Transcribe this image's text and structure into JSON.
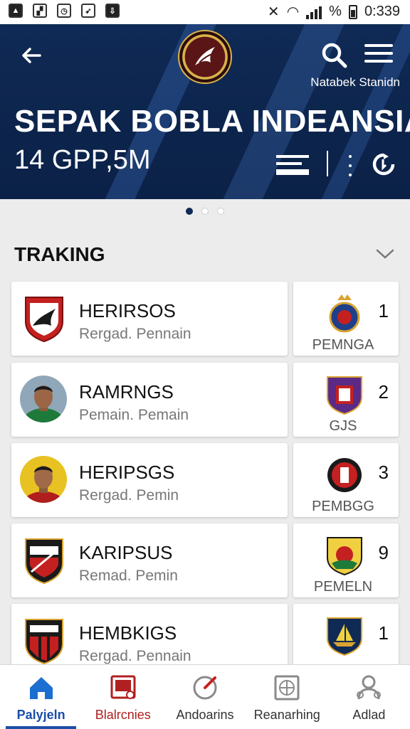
{
  "status_bar": {
    "time": "0:339",
    "battery_text": "%"
  },
  "header": {
    "title": "SEPAK BOBLA INDEANSIA",
    "subtitle": "14 GPP,5M",
    "username": "Natabek Stanidn",
    "logo_icon": "club-crest-icon",
    "accent_color": "#0f2a55"
  },
  "carousel": {
    "page_count": 3,
    "active_index": 0
  },
  "section": {
    "title": "TRAKING"
  },
  "rows": [
    {
      "name": "HERIRSOS",
      "subtitle": "Rergad. Pennain",
      "badge_label": "PEMNGA",
      "rank": "1",
      "avatar": "red-shield-crest",
      "badge": "crown-crest"
    },
    {
      "name": "RAMRNGS",
      "subtitle": "Pemain. Pemain",
      "badge_label": "GJS",
      "rank": "2",
      "avatar": "player-photo-green",
      "badge": "purple-shield-crest"
    },
    {
      "name": "HERIPSGS",
      "subtitle": "Rergad. Pemin",
      "badge_label": "PEMBGG",
      "rank": "3",
      "avatar": "player-photo-yellow",
      "badge": "round-red-crest"
    },
    {
      "name": "KARIPSUS",
      "subtitle": "Remad. Pemin",
      "badge_label": "PEMELN",
      "rank": "9",
      "avatar": "black-red-crest",
      "badge": "yellow-green-crest"
    },
    {
      "name": "HEMBKIGS",
      "subtitle": "Rergad. Pennain",
      "badge_label": "",
      "rank": "1",
      "avatar": "striped-crest",
      "badge": "navy-ship-crest"
    }
  ],
  "bottom_nav": [
    {
      "label": "Palyjeln",
      "icon": "home-icon",
      "active": true
    },
    {
      "label": "Blalrcnies",
      "icon": "board-icon",
      "active": false
    },
    {
      "label": "Andoarins",
      "icon": "compass-icon",
      "active": false
    },
    {
      "label": "Reanarhing",
      "icon": "grid-globe-icon",
      "active": false
    },
    {
      "label": "Adlad",
      "icon": "people-icon",
      "active": false
    }
  ]
}
